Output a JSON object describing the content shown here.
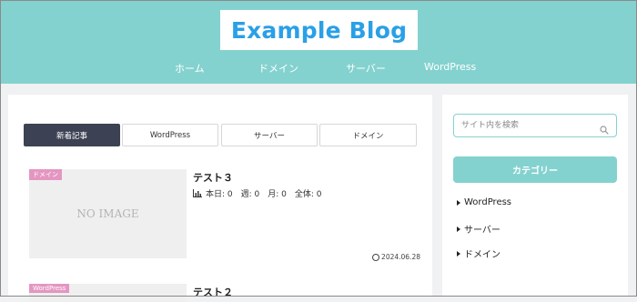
{
  "header": {
    "logo": "Example Blog",
    "nav": [
      "ホーム",
      "ドメイン",
      "サーバー",
      "WordPress"
    ]
  },
  "tabs": [
    "新着記事",
    "WordPress",
    "サーバー",
    "ドメイン"
  ],
  "posts": [
    {
      "category": "ドメイン",
      "category_color": "#e496c1",
      "thumbnail_text": "NO IMAGE",
      "title": "テスト３",
      "views": "本日: 0　週: 0　月: 0　全体: 0",
      "date": "2024.06.28"
    },
    {
      "category": "WordPress",
      "category_color": "#e496c1",
      "title": "テスト２"
    }
  ],
  "sidebar": {
    "search_placeholder": "サイト内を検索",
    "category_heading": "カテゴリー",
    "categories": [
      "WordPress",
      "サーバー",
      "ドメイン"
    ]
  },
  "colors": {
    "accent": "#84d2cf",
    "logo": "#2aa0e6",
    "active_tab": "#3c4253"
  }
}
